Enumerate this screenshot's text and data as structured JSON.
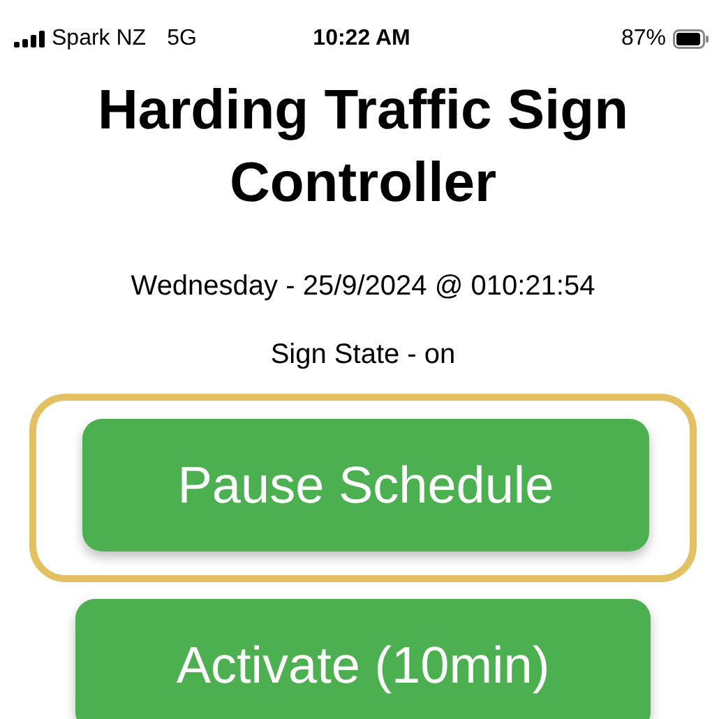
{
  "status_bar": {
    "carrier": "Spark NZ",
    "network": "5G",
    "time": "10:22 AM",
    "battery": "87%"
  },
  "title": "Harding Traffic Sign Controller",
  "datetime": "Wednesday - 25/9/2024 @ 010:21:54",
  "sign_state": "Sign State - on",
  "buttons": [
    {
      "label": "Pause Schedule",
      "highlighted": true
    },
    {
      "label": "Activate (10min)",
      "highlighted": false
    }
  ]
}
